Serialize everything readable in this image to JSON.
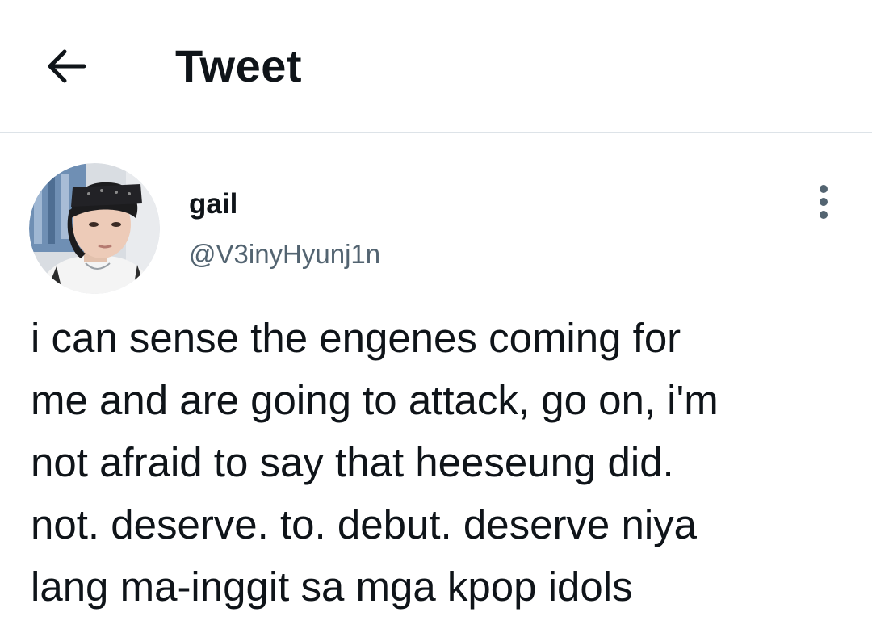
{
  "header": {
    "back_icon": "arrow-left-icon",
    "title": "Tweet"
  },
  "tweet": {
    "author": {
      "display_name": "gail",
      "handle": "@V3inyHyunj1n",
      "avatar": "profile-photo"
    },
    "more_icon": "more-vertical-icon",
    "text": "i can sense the engenes coming for\nme and are going to attack, go on, i'm\nnot afraid to say that heeseung did.\nnot. deserve. to. debut. deserve niya\nlang ma-inggit sa mga kpop idols"
  },
  "colors": {
    "text_primary": "#0f1419",
    "text_secondary": "#536471",
    "divider": "#dde3e8",
    "background": "#ffffff"
  }
}
